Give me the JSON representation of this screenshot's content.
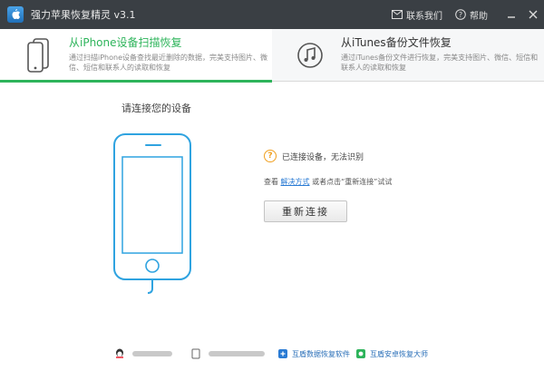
{
  "app": {
    "title": "强力苹果恢复精灵 v3.1"
  },
  "titlebar": {
    "contact_label": "联系我们",
    "help_label": "帮助"
  },
  "tabs": [
    {
      "title": "从iPhone设备扫描恢复",
      "desc": "通过扫描iPhone设备查找最近删除的数据，完美支持图片、微信、短信和联系人的读取和恢复",
      "icon": "phone-icon",
      "active": true
    },
    {
      "title": "从iTunes备份文件恢复",
      "desc": "通过iTunes备份文件进行恢复，完美支持图片、微信、短信和联系人的读取和恢复",
      "icon": "music-note-icon",
      "active": false
    }
  ],
  "main": {
    "heading": "请连接您的设备",
    "status_text": "已连接设备，无法识别",
    "solution_prefix": "查看",
    "solution_link": "解决方式",
    "solution_suffix": "或者点击“重新连接”试试",
    "reconnect_label": "重新连接"
  },
  "footer": {
    "link1": "互盾数据恢复软件",
    "link2": "互盾安卓恢复大师"
  },
  "colors": {
    "accent": "#2eb45b",
    "titlebar": "#3a3f44",
    "link": "#2a7bd4",
    "warning": "#f0a020"
  }
}
